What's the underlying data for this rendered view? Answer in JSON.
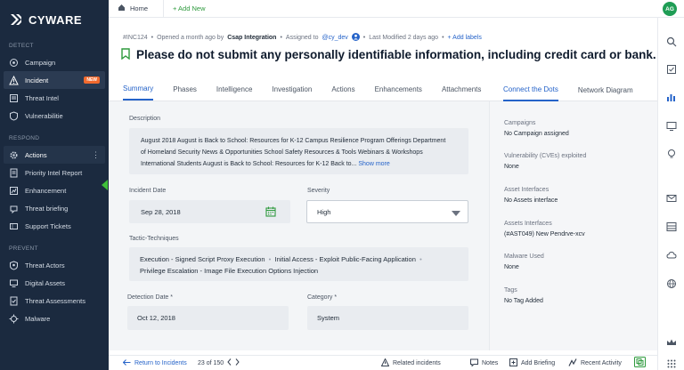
{
  "brand": {
    "name": "CYWARE"
  },
  "sidebar": {
    "sections": [
      {
        "label": "DETECT",
        "items": [
          {
            "label": "Campaign",
            "icon": "campaign-icon"
          },
          {
            "label": "Incident",
            "icon": "incident-icon",
            "badge": "NEW",
            "active": true
          },
          {
            "label": "Threat Intel",
            "icon": "threat-intel-icon"
          },
          {
            "label": "Vulnerabilitie",
            "icon": "shield-icon"
          }
        ]
      },
      {
        "label": "RESPOND",
        "items": [
          {
            "label": "Actions",
            "icon": "gear-icon"
          },
          {
            "label": "Priority Intel Report",
            "icon": "report-icon"
          },
          {
            "label": "Enhancement",
            "icon": "enhancement-icon"
          },
          {
            "label": "Threat briefing",
            "icon": "briefing-icon"
          },
          {
            "label": "Support Tickets",
            "icon": "ticket-icon"
          }
        ]
      },
      {
        "label": "PREVENT",
        "items": [
          {
            "label": "Threat Actors",
            "icon": "actor-icon"
          },
          {
            "label": "Digital Assets",
            "icon": "asset-icon"
          },
          {
            "label": "Threat Assessments",
            "icon": "assessment-icon"
          },
          {
            "label": "Malware",
            "icon": "malware-icon"
          }
        ]
      }
    ]
  },
  "topbar": {
    "home": "Home",
    "add_new": "+ Add New",
    "avatar": "AG"
  },
  "incident": {
    "id": "#INC124",
    "opened": "Opened a month ago by",
    "opened_by": "Csap Integration",
    "assigned_prefix": "Assigned to",
    "assigned_to": "@cy_dev",
    "modified": "Last Modified 2 days ago",
    "add_labels": "+ Add labels",
    "title": "Please do not submit any personally identifiable information, including credit card or bank."
  },
  "tabs": [
    "Summary",
    "Phases",
    "Intelligence",
    "Investigation",
    "Actions",
    "Enhancements",
    "Attachments"
  ],
  "right_tabs": [
    "Connect the Dots",
    "Network Diagram"
  ],
  "summary": {
    "description_label": "Description",
    "description": "August 2018 August is Back to School: Resources for K-12 Campus Resilience Program Offerings Department of Homeland Security News & Opportunities School Safety Resources & Tools Webinars & Workshops International Students August is Back to School: Resources for K-12 Back to...",
    "show_more": "Show more",
    "incident_date_label": "Incident Date",
    "incident_date": "Sep 28, 2018",
    "severity_label": "Severity",
    "severity": "High",
    "tactic_label": "Tactic-Techniques",
    "tactic_1": "Execution - Signed Script Proxy Execution",
    "tactic_2": "Initial Access - Exploit Public-Facing Application",
    "tactic_3": "Privilege Escalation - Image File Execution Options Injection",
    "detection_date_label": "Detection Date *",
    "detection_date": "Oct 12, 2018",
    "category_label": "Category *",
    "category": "System"
  },
  "connect": [
    {
      "label": "Campaigns",
      "value": "No Campaign assigned"
    },
    {
      "label": "Vulnerability (CVEs) exploited",
      "value": "None"
    },
    {
      "label": "Asset Interfaces",
      "value": "No Assets interface"
    },
    {
      "label": "Assets Interfaces",
      "value": "(#AST049) New Pendrve-xcv"
    },
    {
      "label": "Malware Used",
      "value": "None"
    },
    {
      "label": "Tags",
      "value": "No Tag Added"
    }
  ],
  "bottom": {
    "return": "Return to Incidents",
    "pager": "23 of 150",
    "related": "Related incidents",
    "notes": "Notes",
    "add_briefing": "Add Briefing",
    "recent": "Recent Activity"
  },
  "colors": {
    "sidebar": "#1b2a3f",
    "accent": "#2563c9",
    "green": "#2e9a3d",
    "badge": "#f26a2e"
  }
}
